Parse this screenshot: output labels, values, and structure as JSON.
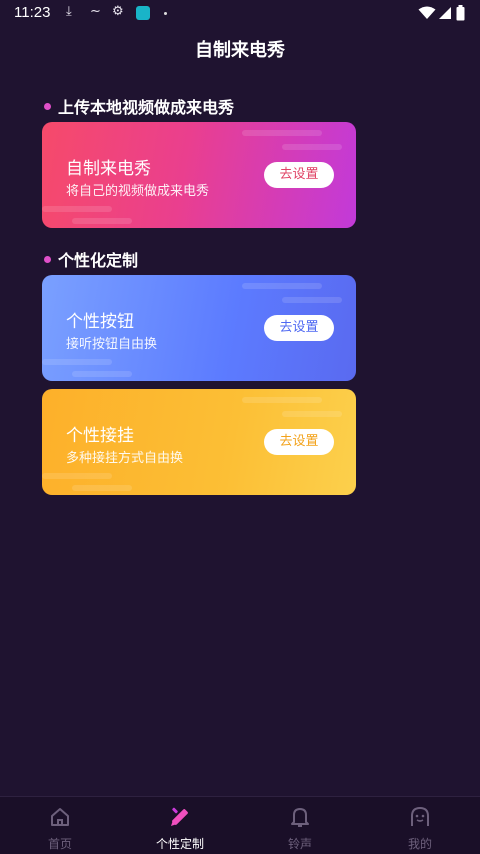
{
  "status_bar": {
    "time": "11:23"
  },
  "page": {
    "title": "自制来电秀"
  },
  "sections": [
    {
      "heading": "上传本地视频做成来电秀"
    },
    {
      "heading": "个性化定制"
    }
  ],
  "cards": [
    {
      "title": "自制来电秀",
      "subtitle": "将自己的视频做成来电秀",
      "button": "去设置"
    },
    {
      "title": "个性按钮",
      "subtitle": "接听按钮自由换",
      "button": "去设置"
    },
    {
      "title": "个性接挂",
      "subtitle": "多种接挂方式自由换",
      "button": "去设置"
    }
  ],
  "tabbar": {
    "items": [
      {
        "label": "首页",
        "icon": "home-icon"
      },
      {
        "label": "个性定制",
        "icon": "pencil-icon",
        "active": true
      },
      {
        "label": "铃声",
        "icon": "bell-icon"
      },
      {
        "label": "我的",
        "icon": "profile-face-icon"
      }
    ]
  },
  "colors": {
    "background": "#1f1330",
    "accent_bullet": "#e04fc9",
    "card1_gradient": [
      "#f64a6a",
      "#c23ad9"
    ],
    "card2_gradient": [
      "#7aa0ff",
      "#5a6af0"
    ],
    "card3_gradient": [
      "#fdb02a",
      "#fcd04c"
    ]
  }
}
